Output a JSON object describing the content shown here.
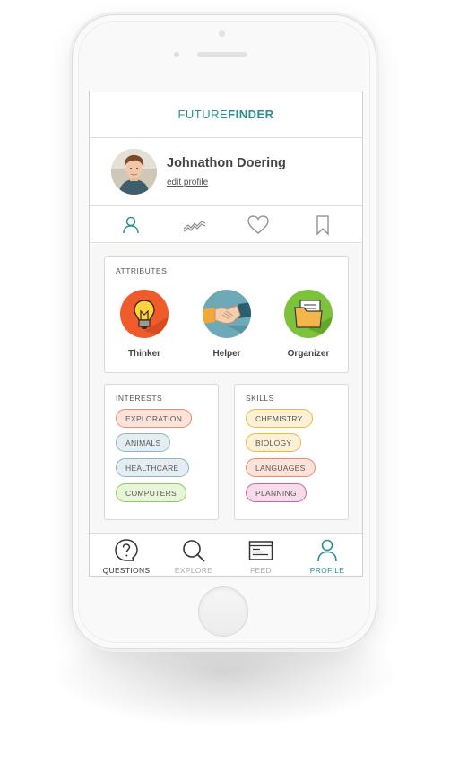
{
  "app": {
    "logo_part1": "FUTURE",
    "logo_part2": "FINDER",
    "accent_color": "#2a8f94"
  },
  "profile": {
    "name": "Johnathon Doering",
    "edit_label": "edit profile"
  },
  "top_tabs": [
    {
      "icon": "person-icon",
      "active": true
    },
    {
      "icon": "trend-line-icon",
      "active": false
    },
    {
      "icon": "heart-icon",
      "active": false
    },
    {
      "icon": "bookmark-icon",
      "active": false
    }
  ],
  "attributes": {
    "title": "ATTRIBUTES",
    "items": [
      {
        "label": "Thinker",
        "icon": "lightbulb-icon",
        "color": "#ef5b2b"
      },
      {
        "label": "Helper",
        "icon": "handshake-icon",
        "color": "#6ea9b8"
      },
      {
        "label": "Organizer",
        "icon": "folder-icon",
        "color": "#7cc23a"
      }
    ]
  },
  "interests": {
    "title": "INTERESTS",
    "items": [
      {
        "label": "EXPLORATION",
        "bg": "#fde3da",
        "border": "#ef8a6a"
      },
      {
        "label": "ANIMALS",
        "bg": "#e4eef2",
        "border": "#8fb4c2"
      },
      {
        "label": "HEALTHCARE",
        "bg": "#e4eef2",
        "border": "#8fb4c2"
      },
      {
        "label": "COMPUTERS",
        "bg": "#e7f5d9",
        "border": "#8ccc5a"
      }
    ]
  },
  "skills": {
    "title": "SKILLS",
    "items": [
      {
        "label": "CHEMISTRY",
        "bg": "#fdf1d5",
        "border": "#e8b94a"
      },
      {
        "label": "BIOLOGY",
        "bg": "#fdf1d5",
        "border": "#e8b94a"
      },
      {
        "label": "LANGUAGES",
        "bg": "#fde3da",
        "border": "#ef8a6a"
      },
      {
        "label": "PLANNING",
        "bg": "#f7dbeb",
        "border": "#c768a0"
      }
    ]
  },
  "bottom_nav": [
    {
      "label": "QUESTIONS",
      "icon": "question-bubble-icon",
      "color": "#333333"
    },
    {
      "label": "EXPLORE",
      "icon": "search-icon",
      "color": "#aaaaaa"
    },
    {
      "label": "FEED",
      "icon": "newspaper-icon",
      "color": "#aaaaaa"
    },
    {
      "label": "PROFILE",
      "icon": "person-icon",
      "color": "#2a8f94"
    }
  ]
}
